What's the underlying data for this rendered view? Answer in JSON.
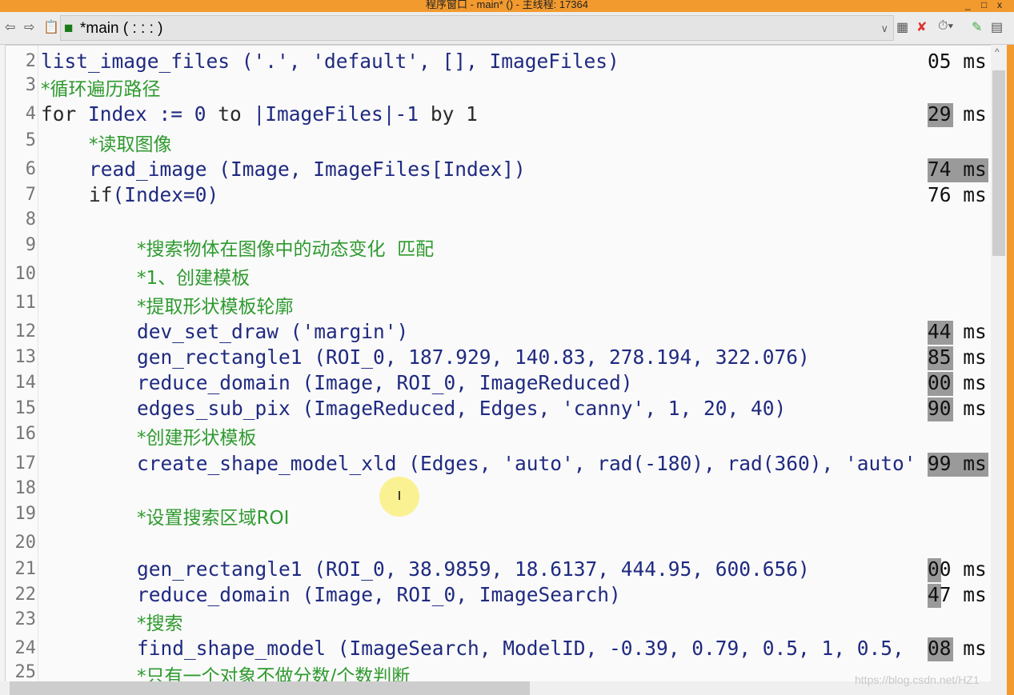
{
  "window": {
    "title": "程序窗口 - main* () - 主线程: 17364",
    "minimize": "_",
    "maximize": "□",
    "close": "x"
  },
  "toolbar": {
    "back": "⇦",
    "forward": "⇨",
    "procedure": "*main ( : : : )",
    "dropdown": "∨"
  },
  "lines": [
    {
      "n": "2",
      "indent": 0,
      "tokens": [
        [
          "list_image_files ('.', 'default', [], ImageFiles)",
          ""
        ]
      ],
      "ms": "05 ms",
      "hl": ""
    },
    {
      "n": "3",
      "indent": 0,
      "tokens": [
        [
          "*循环遍历路径",
          "cm"
        ]
      ],
      "ms": "",
      "hl": ""
    },
    {
      "n": "4",
      "indent": 0,
      "tokens": [
        [
          "for ",
          "kw"
        ],
        [
          "Index := 0 ",
          ""
        ],
        [
          "to ",
          "kw"
        ],
        [
          "|ImageFiles|-1 ",
          ""
        ],
        [
          "by 1",
          "kw"
        ]
      ],
      "ms": "29 ms",
      "hl": "29"
    },
    {
      "n": "5",
      "indent": 1,
      "tokens": [
        [
          "*读取图像",
          "cm"
        ]
      ],
      "ms": "",
      "hl": ""
    },
    {
      "n": "6",
      "indent": 1,
      "tokens": [
        [
          "read_image (Image, ImageFiles[Index])",
          ""
        ]
      ],
      "ms": "74 ms",
      "hl": "74 ms"
    },
    {
      "n": "7",
      "indent": 1,
      "tokens": [
        [
          "if",
          "kw"
        ],
        [
          "(Index=0)",
          ""
        ]
      ],
      "ms": "76 ms",
      "hl": ""
    },
    {
      "n": "8",
      "indent": 0,
      "tokens": [],
      "ms": "",
      "hl": ""
    },
    {
      "n": "9",
      "indent": 2,
      "tokens": [
        [
          "*搜索物体在图像中的动态变化  匹配",
          "cm"
        ]
      ],
      "ms": "",
      "hl": ""
    },
    {
      "n": "10",
      "indent": 2,
      "tokens": [
        [
          "*1、创建模板",
          "cm"
        ]
      ],
      "ms": "",
      "hl": ""
    },
    {
      "n": "11",
      "indent": 2,
      "tokens": [
        [
          "*提取形状模板轮廓",
          "cm"
        ]
      ],
      "ms": "",
      "hl": ""
    },
    {
      "n": "12",
      "indent": 2,
      "tokens": [
        [
          "dev_set_draw ('margin')",
          ""
        ]
      ],
      "ms": "44 ms",
      "hl": "44"
    },
    {
      "n": "13",
      "indent": 2,
      "tokens": [
        [
          "gen_rectangle1 (ROI_0, 187.929, 140.83, 278.194, 322.076)",
          ""
        ]
      ],
      "ms": "85 ms",
      "hl": "85"
    },
    {
      "n": "14",
      "indent": 2,
      "tokens": [
        [
          "reduce_domain (Image, ROI_0, ImageReduced)",
          ""
        ]
      ],
      "ms": "00 ms",
      "hl": "00"
    },
    {
      "n": "15",
      "indent": 2,
      "tokens": [
        [
          "edges_sub_pix (ImageReduced, Edges, 'canny', 1, 20, 40)",
          ""
        ]
      ],
      "ms": "90 ms",
      "hl": "90"
    },
    {
      "n": "16",
      "indent": 2,
      "tokens": [
        [
          "*创建形状模板",
          "cm"
        ]
      ],
      "ms": "",
      "hl": ""
    },
    {
      "n": "17",
      "indent": 2,
      "tokens": [
        [
          "create_shape_model_xld (Edges, 'auto', rad(-180), rad(360), 'auto'",
          ""
        ]
      ],
      "ms": "99 ms",
      "hl": "99 ms"
    },
    {
      "n": "18",
      "indent": 0,
      "tokens": [],
      "ms": "",
      "hl": ""
    },
    {
      "n": "19",
      "indent": 2,
      "tokens": [
        [
          "*设置搜索区域ROI",
          "cm"
        ]
      ],
      "ms": "",
      "hl": ""
    },
    {
      "n": "20",
      "indent": 0,
      "tokens": [],
      "ms": "",
      "hl": ""
    },
    {
      "n": "21",
      "indent": 2,
      "tokens": [
        [
          "gen_rectangle1 (ROI_0, 38.9859, 18.6137, 444.95, 600.656)",
          ""
        ]
      ],
      "ms": "00 ms",
      "hl": "0"
    },
    {
      "n": "22",
      "indent": 2,
      "tokens": [
        [
          "reduce_domain (Image, ROI_0, ImageSearch)",
          ""
        ]
      ],
      "ms": "47 ms",
      "hl": "4"
    },
    {
      "n": "23",
      "indent": 2,
      "tokens": [
        [
          "*搜索",
          "cm"
        ]
      ],
      "ms": "",
      "hl": ""
    },
    {
      "n": "24",
      "indent": 2,
      "tokens": [
        [
          "find_shape_model (ImageSearch, ModelID, -0.39, 0.79, 0.5, 1, 0.5, ",
          ""
        ]
      ],
      "ms": "08 ms",
      "hl": "08"
    },
    {
      "n": "25",
      "indent": 2,
      "tokens": [
        [
          "*只有一个对象不做分数/个数判断",
          "cm"
        ]
      ],
      "ms": "",
      "hl": ""
    }
  ],
  "watermark": "https://blog.csdn.net/HZ1"
}
